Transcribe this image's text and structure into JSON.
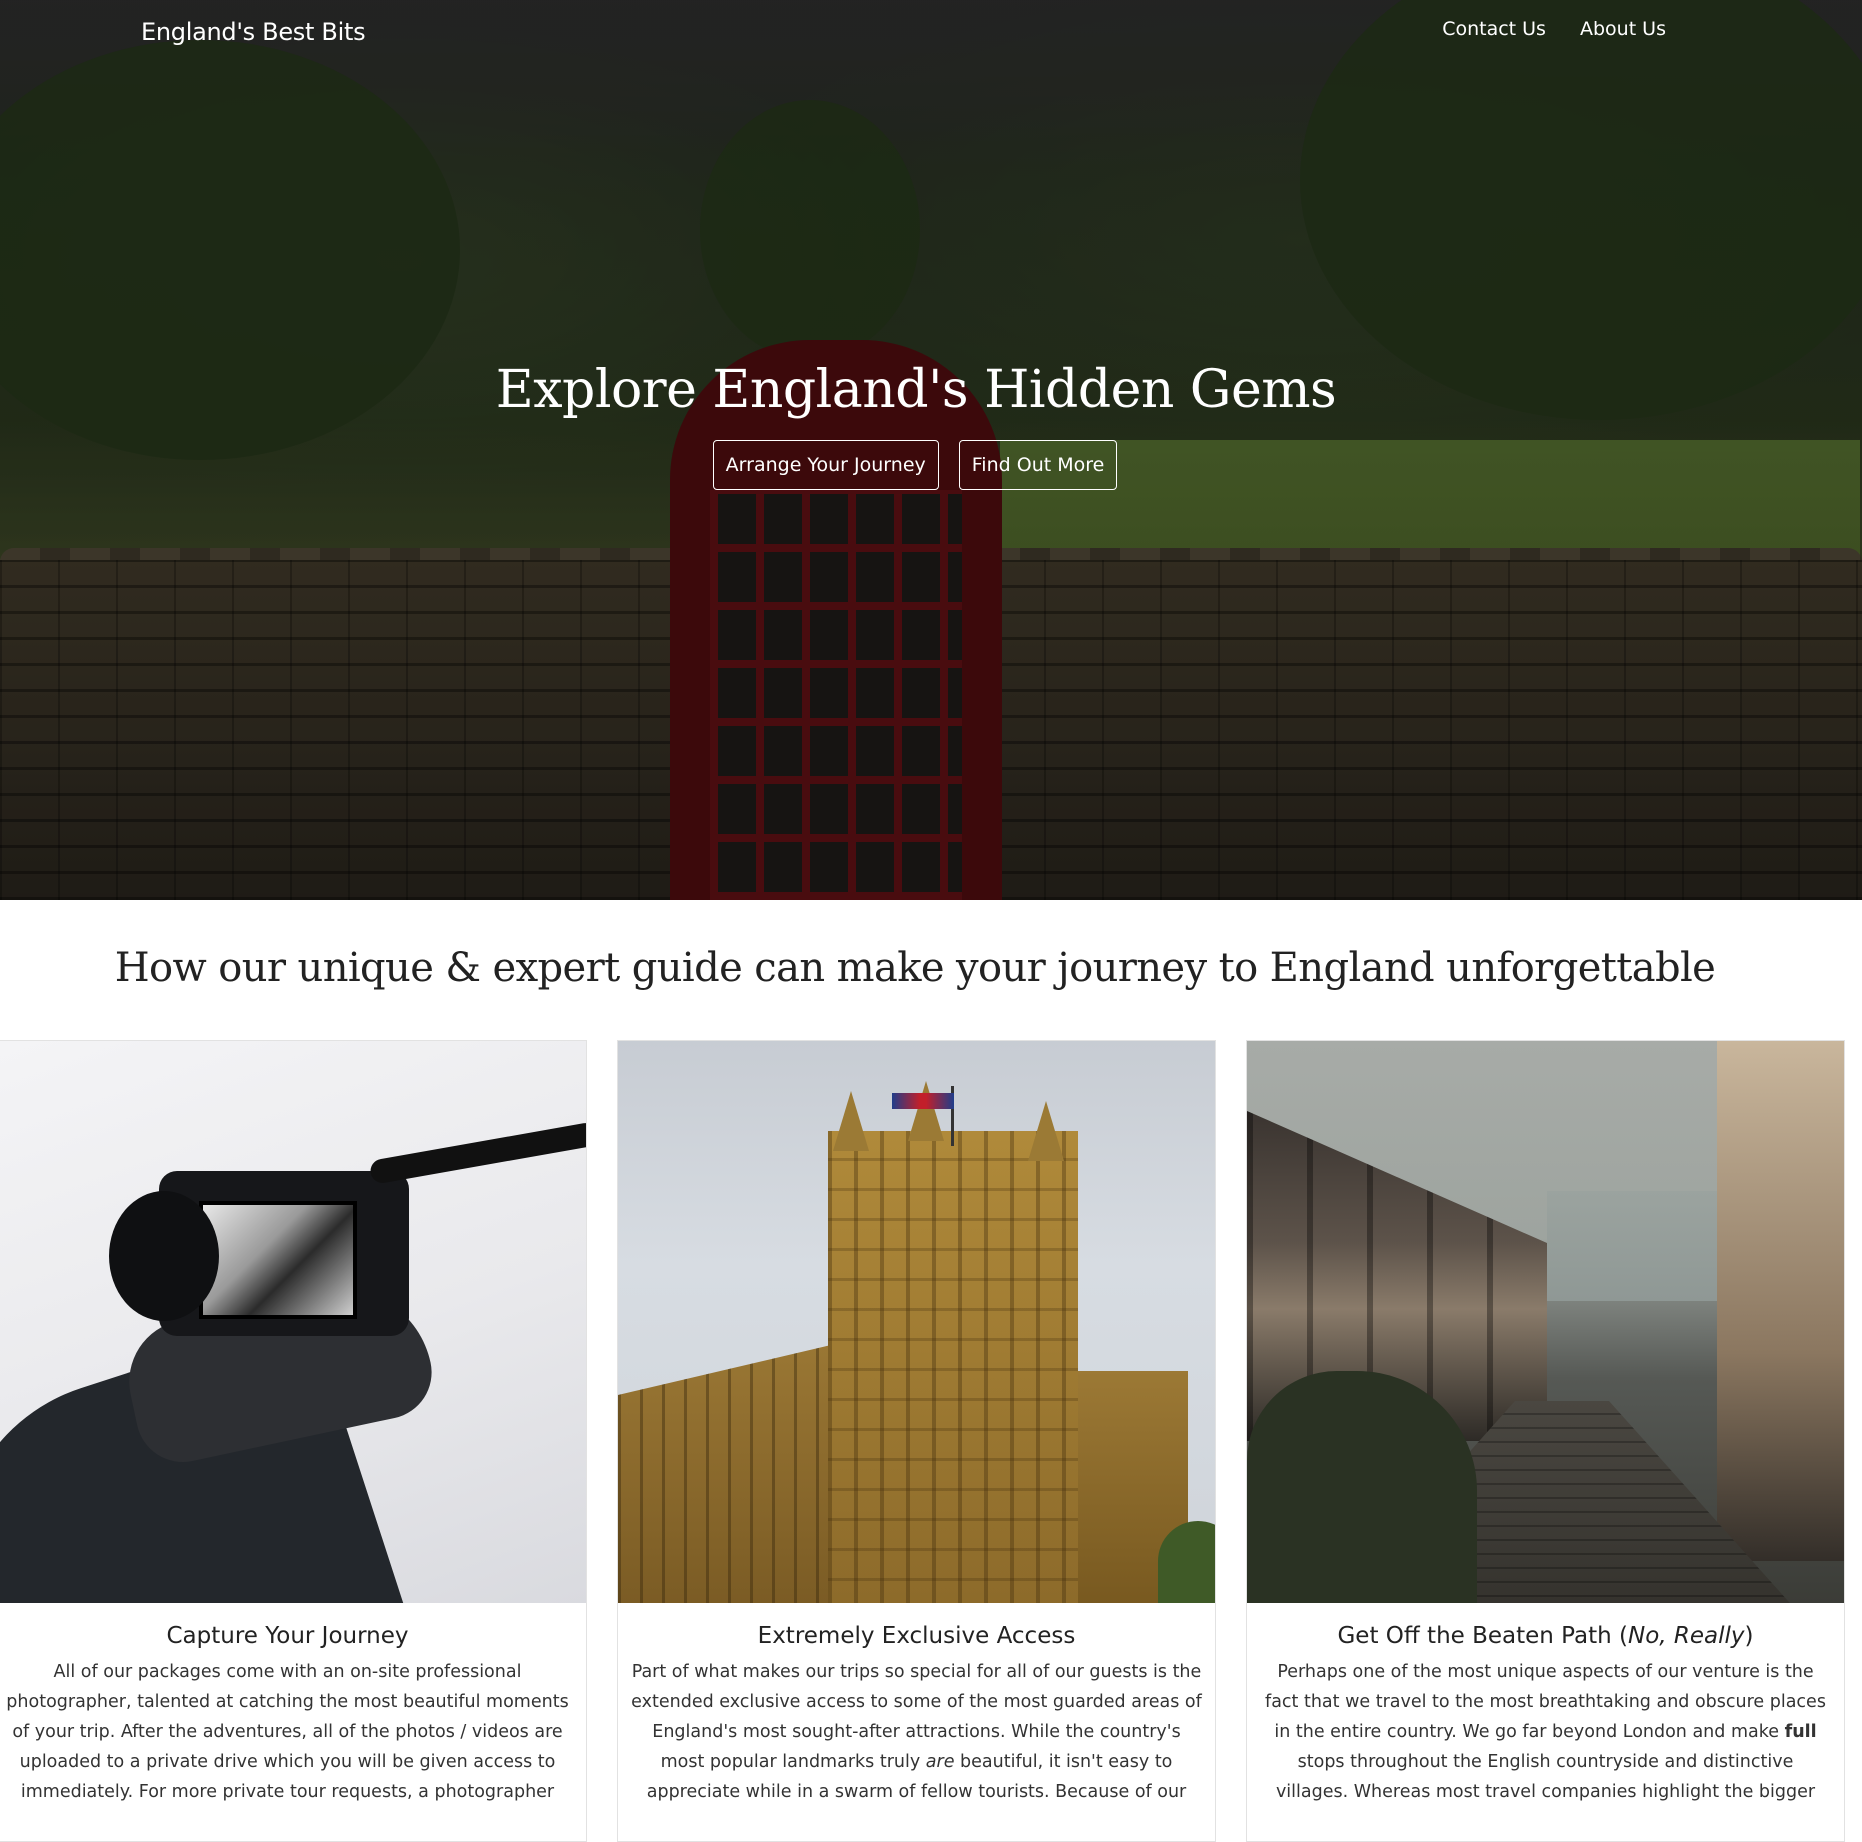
{
  "header": {
    "brand": "England's Best Bits",
    "nav": [
      {
        "label": "Contact Us"
      },
      {
        "label": "About Us"
      }
    ]
  },
  "hero": {
    "title": "Explore England's Hidden Gems",
    "buttons": [
      {
        "label": "Arrange Your Journey"
      },
      {
        "label": "Find Out More"
      }
    ]
  },
  "section": {
    "title": "How our unique & expert guide can make your journey to England unforgettable"
  },
  "cards": [
    {
      "title": "Capture Your Journey",
      "text": "All of our packages come with an on-site professional photographer, talented at catching the most beautiful moments of your trip. After the adventures, all of the photos / videos are uploaded to a private drive which you will be given access to immediately. For more private tour requests, a photographer"
    },
    {
      "title": "Extremely Exclusive Access",
      "text_before": "Part of what makes our trips so special for all of our guests is the extended exclusive access to some of the most guarded areas of England's most sought-after attractions. While the country's most popular landmarks truly",
      "text_em": "are",
      "text_after": "beautiful, it isn't easy to appreciate while in a swarm of fellow tourists. Because of our"
    },
    {
      "title_main": "Get Off the Beaten Path (",
      "title_em": "No, Really",
      "title_end": ")",
      "text_before": "Perhaps one of the most unique aspects of our venture is the fact that we travel to the most breathtaking and obscure places in the entire country. We go far beyond London and make",
      "text_strong": "full",
      "text_after": "stops throughout the English countryside and distinctive villages. Whereas most travel companies highlight the bigger"
    }
  ]
}
